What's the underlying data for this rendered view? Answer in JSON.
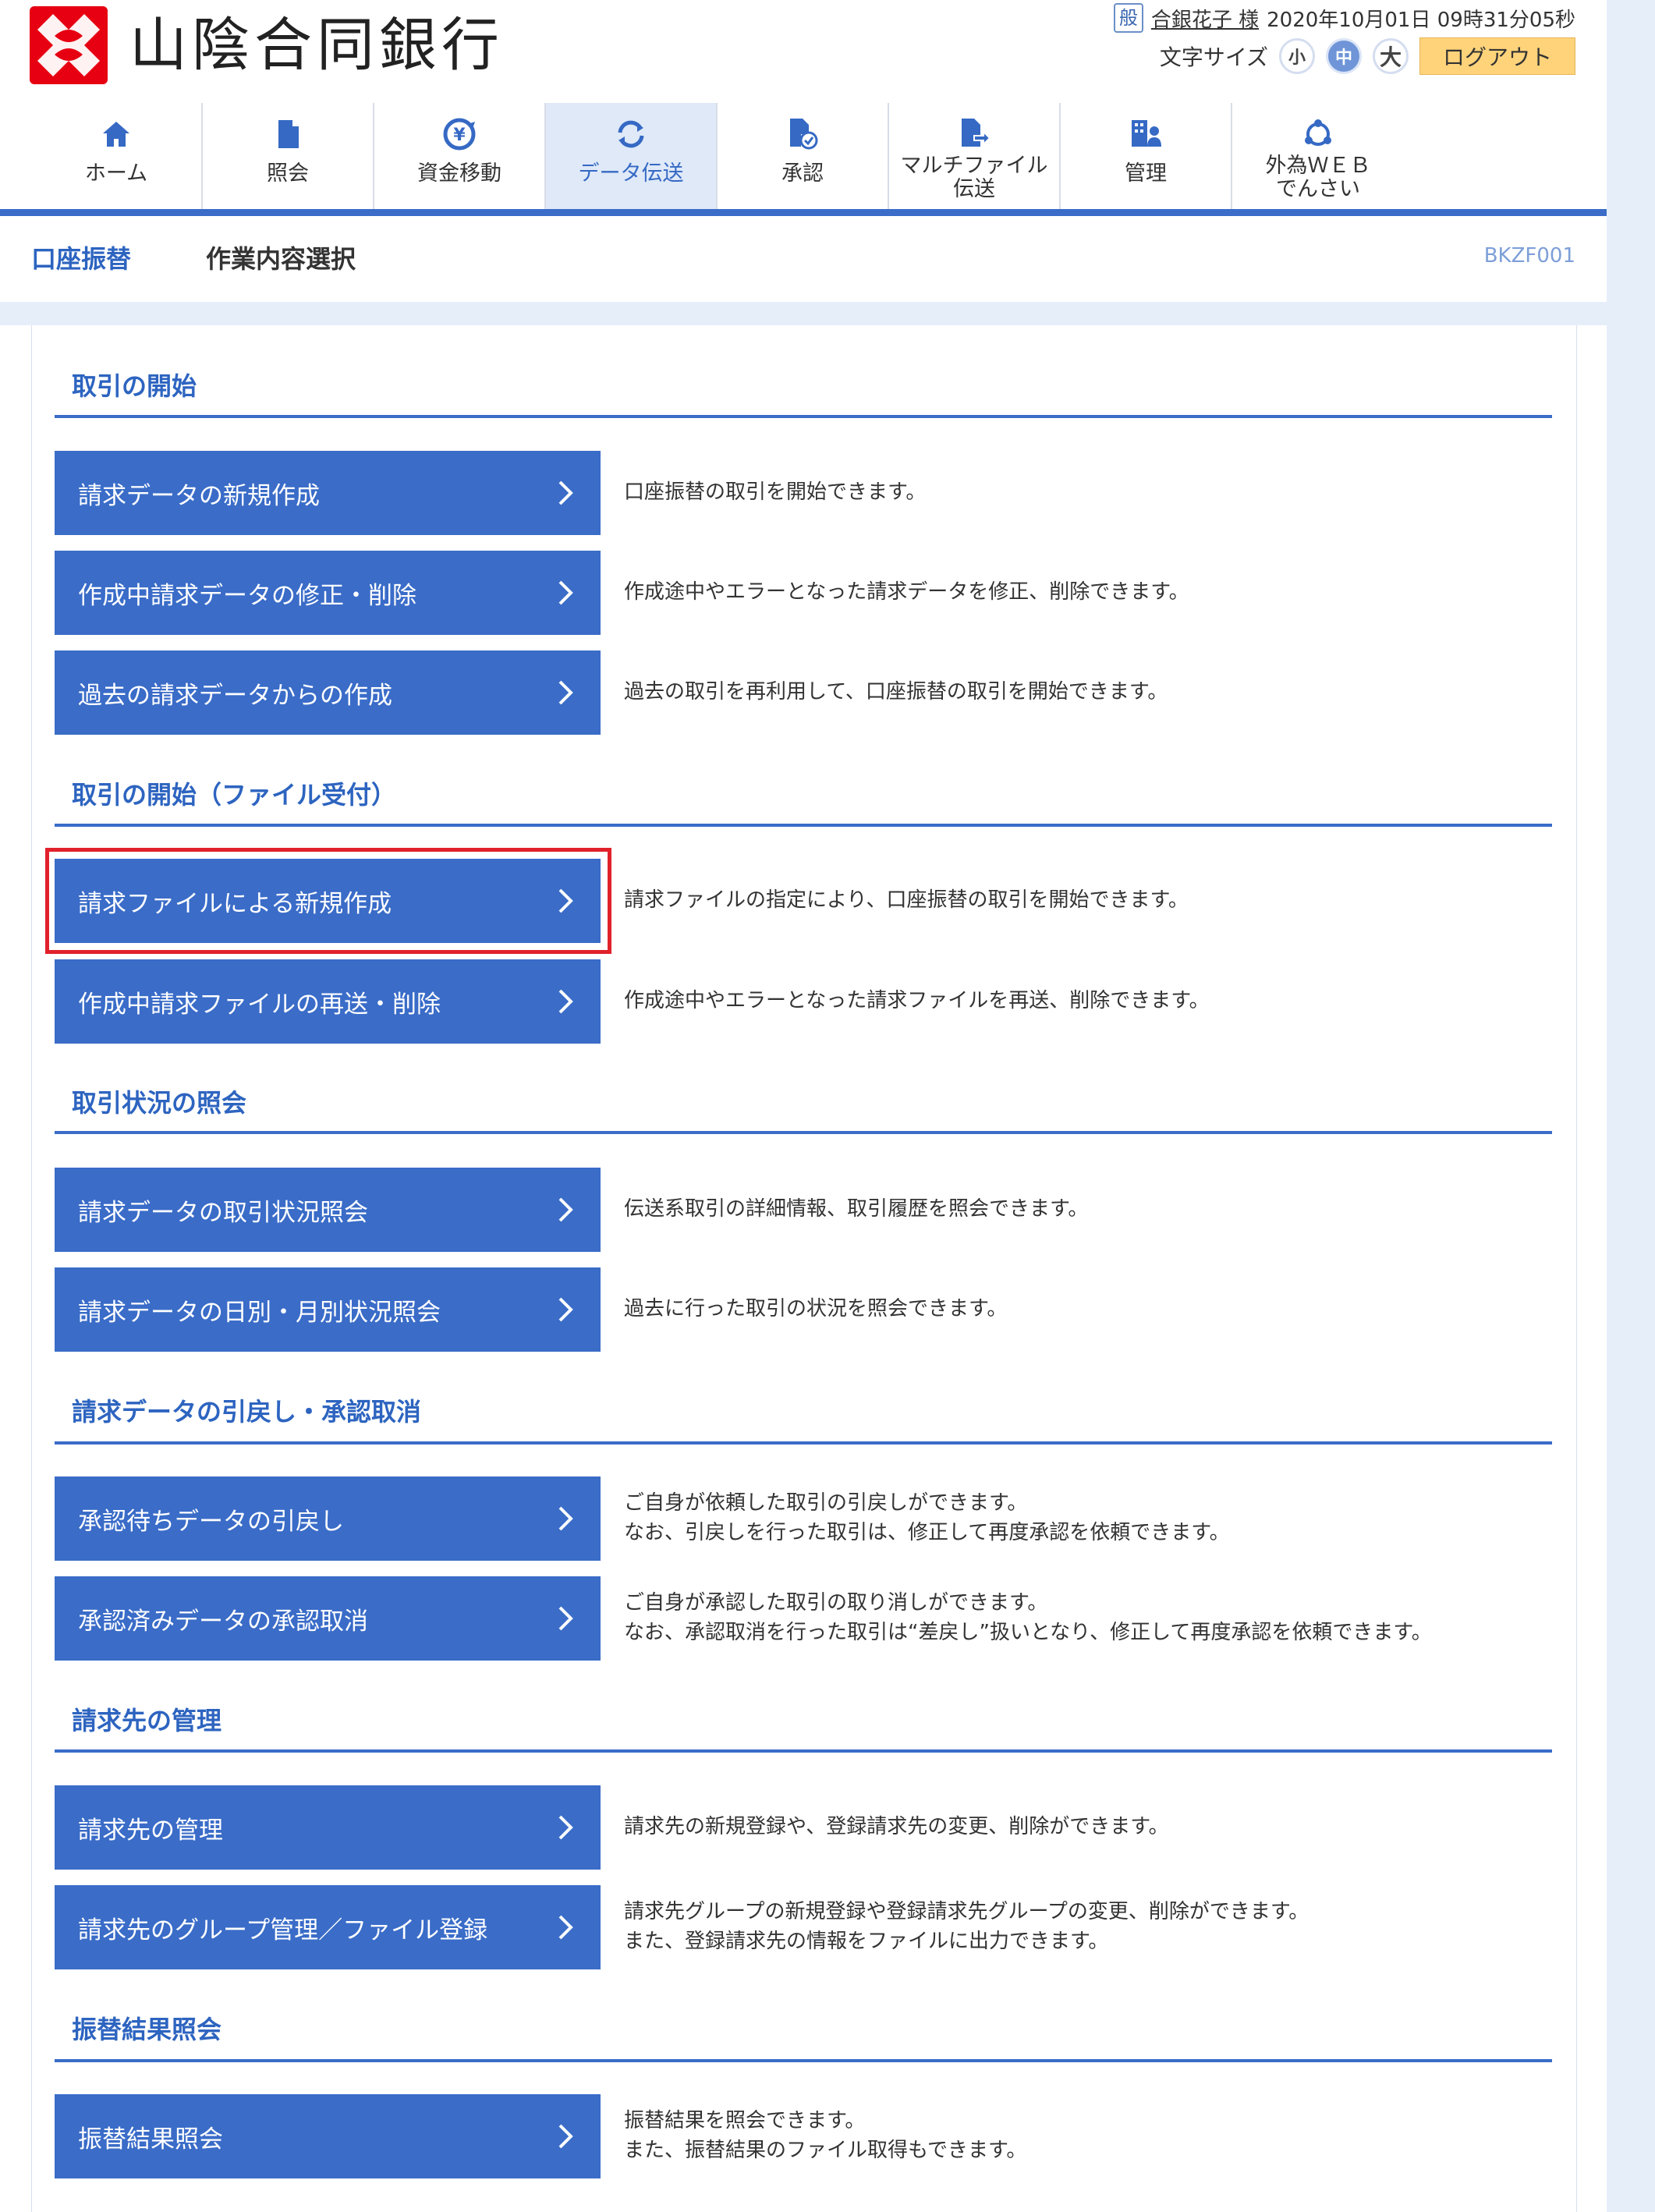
{
  "header": {
    "bank_name": "山陰合同銀行",
    "user_badge": "般",
    "user_name": "合銀花子 様",
    "datetime": "2020年10月01日 09時31分05秒",
    "font_size_label": "文字サイズ",
    "font_small": "小",
    "font_medium": "中",
    "font_large": "大",
    "logout_label": "ログアウト"
  },
  "nav": {
    "items": [
      {
        "label": "ホーム",
        "icon": "home-icon"
      },
      {
        "label": "照会",
        "icon": "document-icon"
      },
      {
        "label": "資金移動",
        "icon": "yen-transfer-icon"
      },
      {
        "label": "データ伝送",
        "icon": "sync-icon"
      },
      {
        "label": "承認",
        "icon": "approval-icon"
      },
      {
        "label_line1": "マルチファイル",
        "label_line2": "伝送",
        "icon": "multi-file-icon"
      },
      {
        "label": "管理",
        "icon": "admin-icon"
      },
      {
        "label_line1": "外為ＷＥＢ",
        "label_line2": "でんさい",
        "icon": "network-icon"
      }
    ],
    "active": "データ伝送"
  },
  "title": {
    "main": "口座振替",
    "sub": "作業内容選択",
    "code": "BKZF001"
  },
  "sections": [
    {
      "title": "取引の開始",
      "items": [
        {
          "button": "請求データの新規作成",
          "desc": "口座振替の取引を開始できます。"
        },
        {
          "button": "作成中請求データの修正・削除",
          "desc": "作成途中やエラーとなった請求データを修正、削除できます。"
        },
        {
          "button": "過去の請求データからの作成",
          "desc": "過去の取引を再利用して、口座振替の取引を開始できます。"
        }
      ]
    },
    {
      "title": "取引の開始（ファイル受付）",
      "items": [
        {
          "button": "請求ファイルによる新規作成",
          "desc": "請求ファイルの指定により、口座振替の取引を開始できます。"
        },
        {
          "button": "作成中請求ファイルの再送・削除",
          "desc": "作成途中やエラーとなった請求ファイルを再送、削除できます。"
        }
      ]
    },
    {
      "title": "取引状況の照会",
      "items": [
        {
          "button": "請求データの取引状況照会",
          "desc": "伝送系取引の詳細情報、取引履歴を照会できます。"
        },
        {
          "button": "請求データの日別・月別状況照会",
          "desc": "過去に行った取引の状況を照会できます。"
        }
      ]
    },
    {
      "title": "請求データの引戻し・承認取消",
      "items": [
        {
          "button": "承認待ちデータの引戻し",
          "desc1": "ご自身が依頼した取引の引戻しができます。",
          "desc2": "なお、引戻しを行った取引は、修正して再度承認を依頼できます。"
        },
        {
          "button": "承認済みデータの承認取消",
          "desc1": "ご自身が承認した取引の取り消しができます。",
          "desc2": "なお、承認取消を行った取引は“差戻し”扱いとなり、修正して再度承認を依頼できます。"
        }
      ]
    },
    {
      "title": "請求先の管理",
      "items": [
        {
          "button": "請求先の管理",
          "desc": "請求先の新規登録や、登録請求先の変更、削除ができます。"
        },
        {
          "button": "請求先のグループ管理／ファイル登録",
          "desc1": "請求先グループの新規登録や登録請求先グループの変更、削除ができます。",
          "desc2": "また、登録請求先の情報をファイルに出力できます。"
        }
      ]
    },
    {
      "title": "振替結果照会",
      "items": [
        {
          "button": "振替結果照会",
          "desc1": "振替結果を照会できます。",
          "desc2": "また、振替結果のファイル取得もできます。"
        }
      ]
    }
  ],
  "colors": {
    "primary": "#3a6cc8",
    "accent_yellow": "#ffd37a",
    "highlight": "#e0212b",
    "logo_red": "#e60012"
  }
}
